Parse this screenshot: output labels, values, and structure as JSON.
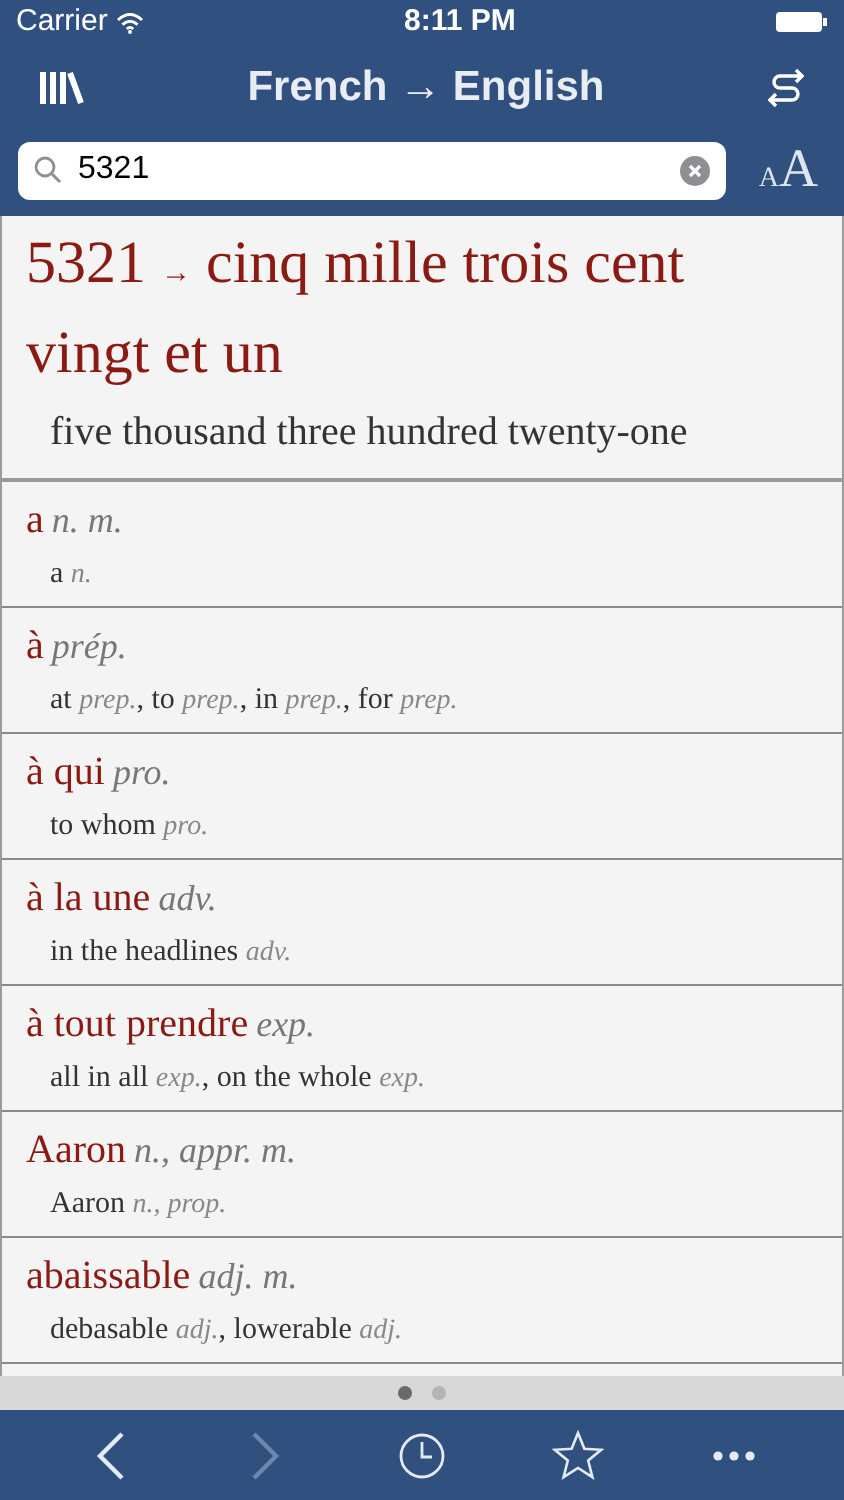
{
  "status_bar": {
    "carrier": "Carrier",
    "time": "8:11 PM"
  },
  "nav": {
    "title": "French → English"
  },
  "search": {
    "value": "5321"
  },
  "font_size_button": {
    "small": "A",
    "large": "A"
  },
  "result": {
    "term": "5321",
    "arrow": "→",
    "translation": "cinq mille trois cent vingt et un",
    "gloss": "five thousand three hundred twenty-one"
  },
  "entries": [
    {
      "headword": "a",
      "pos": "n. m.",
      "translations": "a *n.*"
    },
    {
      "headword": "à",
      "pos": "prép.",
      "translations": "at *prep.*, to *prep.*, in *prep.*, for *prep.*"
    },
    {
      "headword": "à qui",
      "pos": "pro.",
      "translations": "to whom *pro.*"
    },
    {
      "headword": "à la une",
      "pos": "adv.",
      "translations": "in the headlines *adv.*"
    },
    {
      "headword": "à tout prendre",
      "pos": "exp.",
      "translations": "all in all *exp.*, on the whole *exp.*"
    },
    {
      "headword": "Aaron",
      "pos": "n., appr. m.",
      "translations": "Aaron *n., prop.*"
    },
    {
      "headword": "abaissable",
      "pos": "adj. m.",
      "translations": "debasable *adj.*, lowerable *adj.*"
    }
  ],
  "page_dots": [
    {
      "selected": true
    },
    {
      "selected": false
    }
  ],
  "toolbar": [
    {
      "kind": "back",
      "disabled": false
    },
    {
      "kind": "forward",
      "disabled": true
    },
    {
      "kind": "history",
      "disabled": false
    },
    {
      "kind": "favorite",
      "disabled": false
    },
    {
      "kind": "more",
      "disabled": false
    }
  ]
}
